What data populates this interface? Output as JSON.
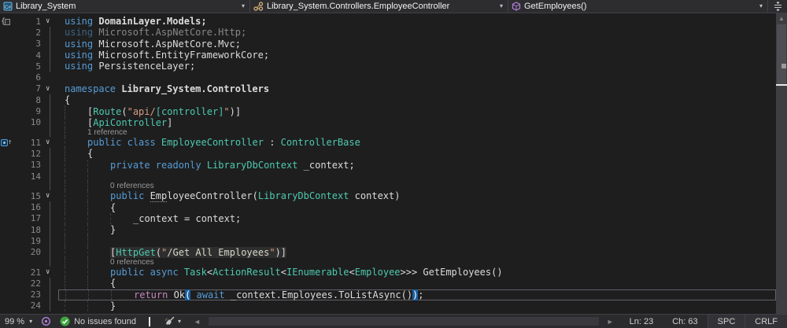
{
  "navbar": {
    "project": {
      "label": "Library_System",
      "icon": "csharp-project-icon"
    },
    "type": {
      "label": "Library_System.Controllers.EmployeeController",
      "icon": "class-icon"
    },
    "member": {
      "label": "GetEmployees()",
      "icon": "method-icon"
    }
  },
  "icons": {
    "caret_down": "▾",
    "arrow_left": "◄",
    "arrow_right": "►",
    "arrow_up": "▲",
    "up_arrow": "↑",
    "chevron_expanded": "∨"
  },
  "colors": {
    "keyword": "#569cd6",
    "control_keyword": "#c586c0",
    "type": "#4ec9b0",
    "string": "#d69d85",
    "plain": "#dcdcdc",
    "codelens": "#9a9a9a",
    "brace_match_bg": "#1b5fa0",
    "issues_ok": "#3fa43f",
    "method_icon_purple": "#b180d7",
    "class_icon_gold": "#dcb67a"
  },
  "editor": {
    "rows": [
      {
        "num": "1",
        "g": 0,
        "outline": "chev",
        "glyph": "brace",
        "tokens": [
          [
            "kw",
            "using "
          ],
          [
            "pl b",
            "DomainLayer.Models;"
          ]
        ]
      },
      {
        "num": "2",
        "g": 0,
        "outline": "line",
        "dim": true,
        "tokens": [
          [
            "kw",
            "using "
          ],
          [
            "pl",
            "Microsoft.AspNetCore.Http;"
          ]
        ]
      },
      {
        "num": "3",
        "g": 0,
        "outline": "line",
        "tokens": [
          [
            "kw",
            "using "
          ],
          [
            "pl",
            "Microsoft.AspNetCore.Mvc;"
          ]
        ]
      },
      {
        "num": "4",
        "g": 0,
        "outline": "line",
        "tokens": [
          [
            "kw",
            "using "
          ],
          [
            "pl",
            "Microsoft.EntityFrameworkCore;"
          ]
        ]
      },
      {
        "num": "5",
        "g": 0,
        "outline": "line",
        "tokens": [
          [
            "kw",
            "using "
          ],
          [
            "pl",
            "PersistenceLayer;"
          ]
        ]
      },
      {
        "num": "6",
        "g": 0,
        "outline": "",
        "tokens": []
      },
      {
        "num": "7",
        "g": 0,
        "outline": "chev",
        "tokens": [
          [
            "kw",
            "namespace "
          ],
          [
            "pl b",
            "Library_System.Controllers"
          ]
        ]
      },
      {
        "num": "8",
        "g": 0,
        "outline": "line",
        "tokens": [
          [
            "pl",
            "{"
          ]
        ]
      },
      {
        "num": "9",
        "g": 1,
        "outline": "line",
        "tokens": [
          [
            "pl",
            "["
          ],
          [
            "ty",
            "Route"
          ],
          [
            "pl",
            "("
          ],
          [
            "str",
            "\"api/"
          ],
          [
            "ty",
            "[controller]"
          ],
          [
            "str",
            "\""
          ],
          [
            "pl",
            ")]"
          ]
        ]
      },
      {
        "num": "10",
        "g": 1,
        "outline": "line",
        "tokens": [
          [
            "pl",
            "["
          ],
          [
            "ty",
            "ApiController"
          ],
          [
            "pl",
            "]"
          ]
        ]
      },
      {
        "cl": true,
        "g": 1,
        "outline": "line",
        "tokens": [
          [
            "clt",
            "1 reference"
          ]
        ]
      },
      {
        "num": "11",
        "g": 1,
        "outline": "chev",
        "glyph": "bookmark",
        "tokens": [
          [
            "kw",
            "public class "
          ],
          [
            "ty",
            "EmployeeController"
          ],
          [
            "pl",
            " : "
          ],
          [
            "ty",
            "ControllerBase"
          ]
        ]
      },
      {
        "num": "12",
        "g": 1,
        "outline": "line",
        "tokens": [
          [
            "pl",
            "{"
          ]
        ]
      },
      {
        "num": "13",
        "g": 2,
        "outline": "line",
        "tokens": [
          [
            "kw",
            "private readonly "
          ],
          [
            "ty",
            "LibraryDbContext"
          ],
          [
            "pl",
            " _context;"
          ]
        ]
      },
      {
        "num": "14",
        "g": 2,
        "outline": "line",
        "tokens": []
      },
      {
        "cl": true,
        "g": 2,
        "outline": "line",
        "tokens": [
          [
            "clt",
            "0 references"
          ]
        ]
      },
      {
        "num": "15",
        "g": 2,
        "outline": "chev",
        "tokens": [
          [
            "kw",
            "public "
          ],
          [
            "pl sug",
            "Emp"
          ],
          [
            "pl",
            "loyeeController("
          ],
          [
            "ty",
            "LibraryDbContext"
          ],
          [
            "pl",
            " context)"
          ]
        ]
      },
      {
        "num": "16",
        "g": 2,
        "outline": "line",
        "tokens": [
          [
            "pl",
            "{"
          ]
        ]
      },
      {
        "num": "17",
        "g": 3,
        "outline": "line",
        "tokens": [
          [
            "pl",
            "_context = context;"
          ]
        ]
      },
      {
        "num": "18",
        "g": 2,
        "outline": "line",
        "tokens": [
          [
            "pl",
            "}"
          ]
        ]
      },
      {
        "num": "19",
        "g": 2,
        "outline": "line",
        "tokens": []
      },
      {
        "num": "20",
        "g": 2,
        "outline": "line",
        "hl": true,
        "tokens": [
          [
            "pl",
            "["
          ],
          [
            "ty",
            "HttpGet"
          ],
          [
            "pl",
            "("
          ],
          [
            "str",
            "\""
          ],
          [
            "strl",
            "/Get All Employees"
          ],
          [
            "str",
            "\""
          ],
          [
            "pl",
            ")]"
          ]
        ]
      },
      {
        "cl": true,
        "g": 2,
        "outline": "line",
        "tokens": [
          [
            "clt",
            "0 references"
          ]
        ]
      },
      {
        "num": "21",
        "g": 2,
        "outline": "chev",
        "tokens": [
          [
            "kw",
            "public async "
          ],
          [
            "ty",
            "Task"
          ],
          [
            "pl",
            "<"
          ],
          [
            "ty",
            "ActionResult"
          ],
          [
            "pl",
            "<"
          ],
          [
            "ty",
            "IEnumerable"
          ],
          [
            "pl",
            "<"
          ],
          [
            "ty",
            "Employee"
          ],
          [
            "pl",
            ">>> GetEmployees()"
          ]
        ]
      },
      {
        "num": "22",
        "g": 2,
        "outline": "line",
        "tokens": [
          [
            "pl",
            "{"
          ]
        ]
      },
      {
        "num": "23",
        "g": 3,
        "outline": "line",
        "cur": true,
        "tokens": [
          [
            "ctl",
            "return "
          ],
          [
            "pl",
            "Ok"
          ],
          [
            "hi",
            "("
          ],
          [
            "pl",
            " "
          ],
          [
            "kw",
            "await"
          ],
          [
            "pl",
            " _context.Employees.ToListAsync()"
          ],
          [
            "hi",
            ")"
          ],
          [
            "pl",
            ";"
          ]
        ]
      },
      {
        "num": "24",
        "g": 2,
        "outline": "line",
        "tokens": [
          [
            "pl",
            "}"
          ]
        ]
      }
    ]
  },
  "statusbar": {
    "zoom": "99 %",
    "issues": "No issues found",
    "line": "Ln: 23",
    "char": "Ch: 63",
    "spaces": "SPC",
    "line_endings": "CRLF"
  }
}
